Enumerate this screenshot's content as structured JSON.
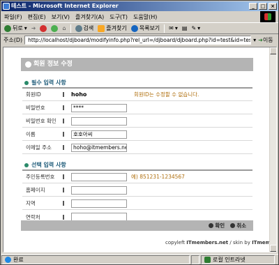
{
  "window": {
    "title": "테스트 - Microsoft Internet Explorer"
  },
  "menu": [
    "파일(F)",
    "편집(E)",
    "보기(V)",
    "즐겨찾기(A)",
    "도구(T)",
    "도움말(H)"
  ],
  "toolbar": {
    "back": "뒤로",
    "search": "검색",
    "favorites": "즐겨찾기",
    "media": "목록보기"
  },
  "address": {
    "label": "주소(D)",
    "url": "http://localhost/djboard/modifyinfo.php?rel_url=/djboard/djboard.php?id=test&id=test",
    "go": "이동"
  },
  "page": {
    "header": "회원 정보 수정",
    "required_section": "필수 입력 사항",
    "optional_section": "선택 입력 사항",
    "required_fields": [
      {
        "label": "회원ID",
        "value": "hoho",
        "note": "회원ID는 수정할 수 없습니다."
      },
      {
        "label": "비밀번호",
        "value": "****"
      },
      {
        "label": "비밀번호 확인",
        "value": ""
      },
      {
        "label": "이름",
        "value": "호호아씨"
      },
      {
        "label": "이메일 주소",
        "value": "hoho@itmembers.net"
      }
    ],
    "optional_fields": [
      {
        "label": "주민등록번호",
        "value": "",
        "note": "예) 851231-1234567"
      },
      {
        "label": "홈페이지",
        "value": ""
      },
      {
        "label": "지역",
        "value": ""
      },
      {
        "label": "연락처",
        "value": ""
      }
    ],
    "confirm_label": "확인",
    "cancel_label": "취소",
    "footer_copyleft": "copyleft",
    "footer_site": "ITmembers.net",
    "footer_skin": "/ skin by",
    "footer_skin_site": "ITmembers.net"
  },
  "status": {
    "left": "완료",
    "zone": "로컬 인트라넷"
  },
  "colors": {
    "title_gradient_start": "#0a246a",
    "header_gray": "#b4b4b4",
    "section_teal": "#1f5c7a",
    "note_orange": "#b07010"
  }
}
